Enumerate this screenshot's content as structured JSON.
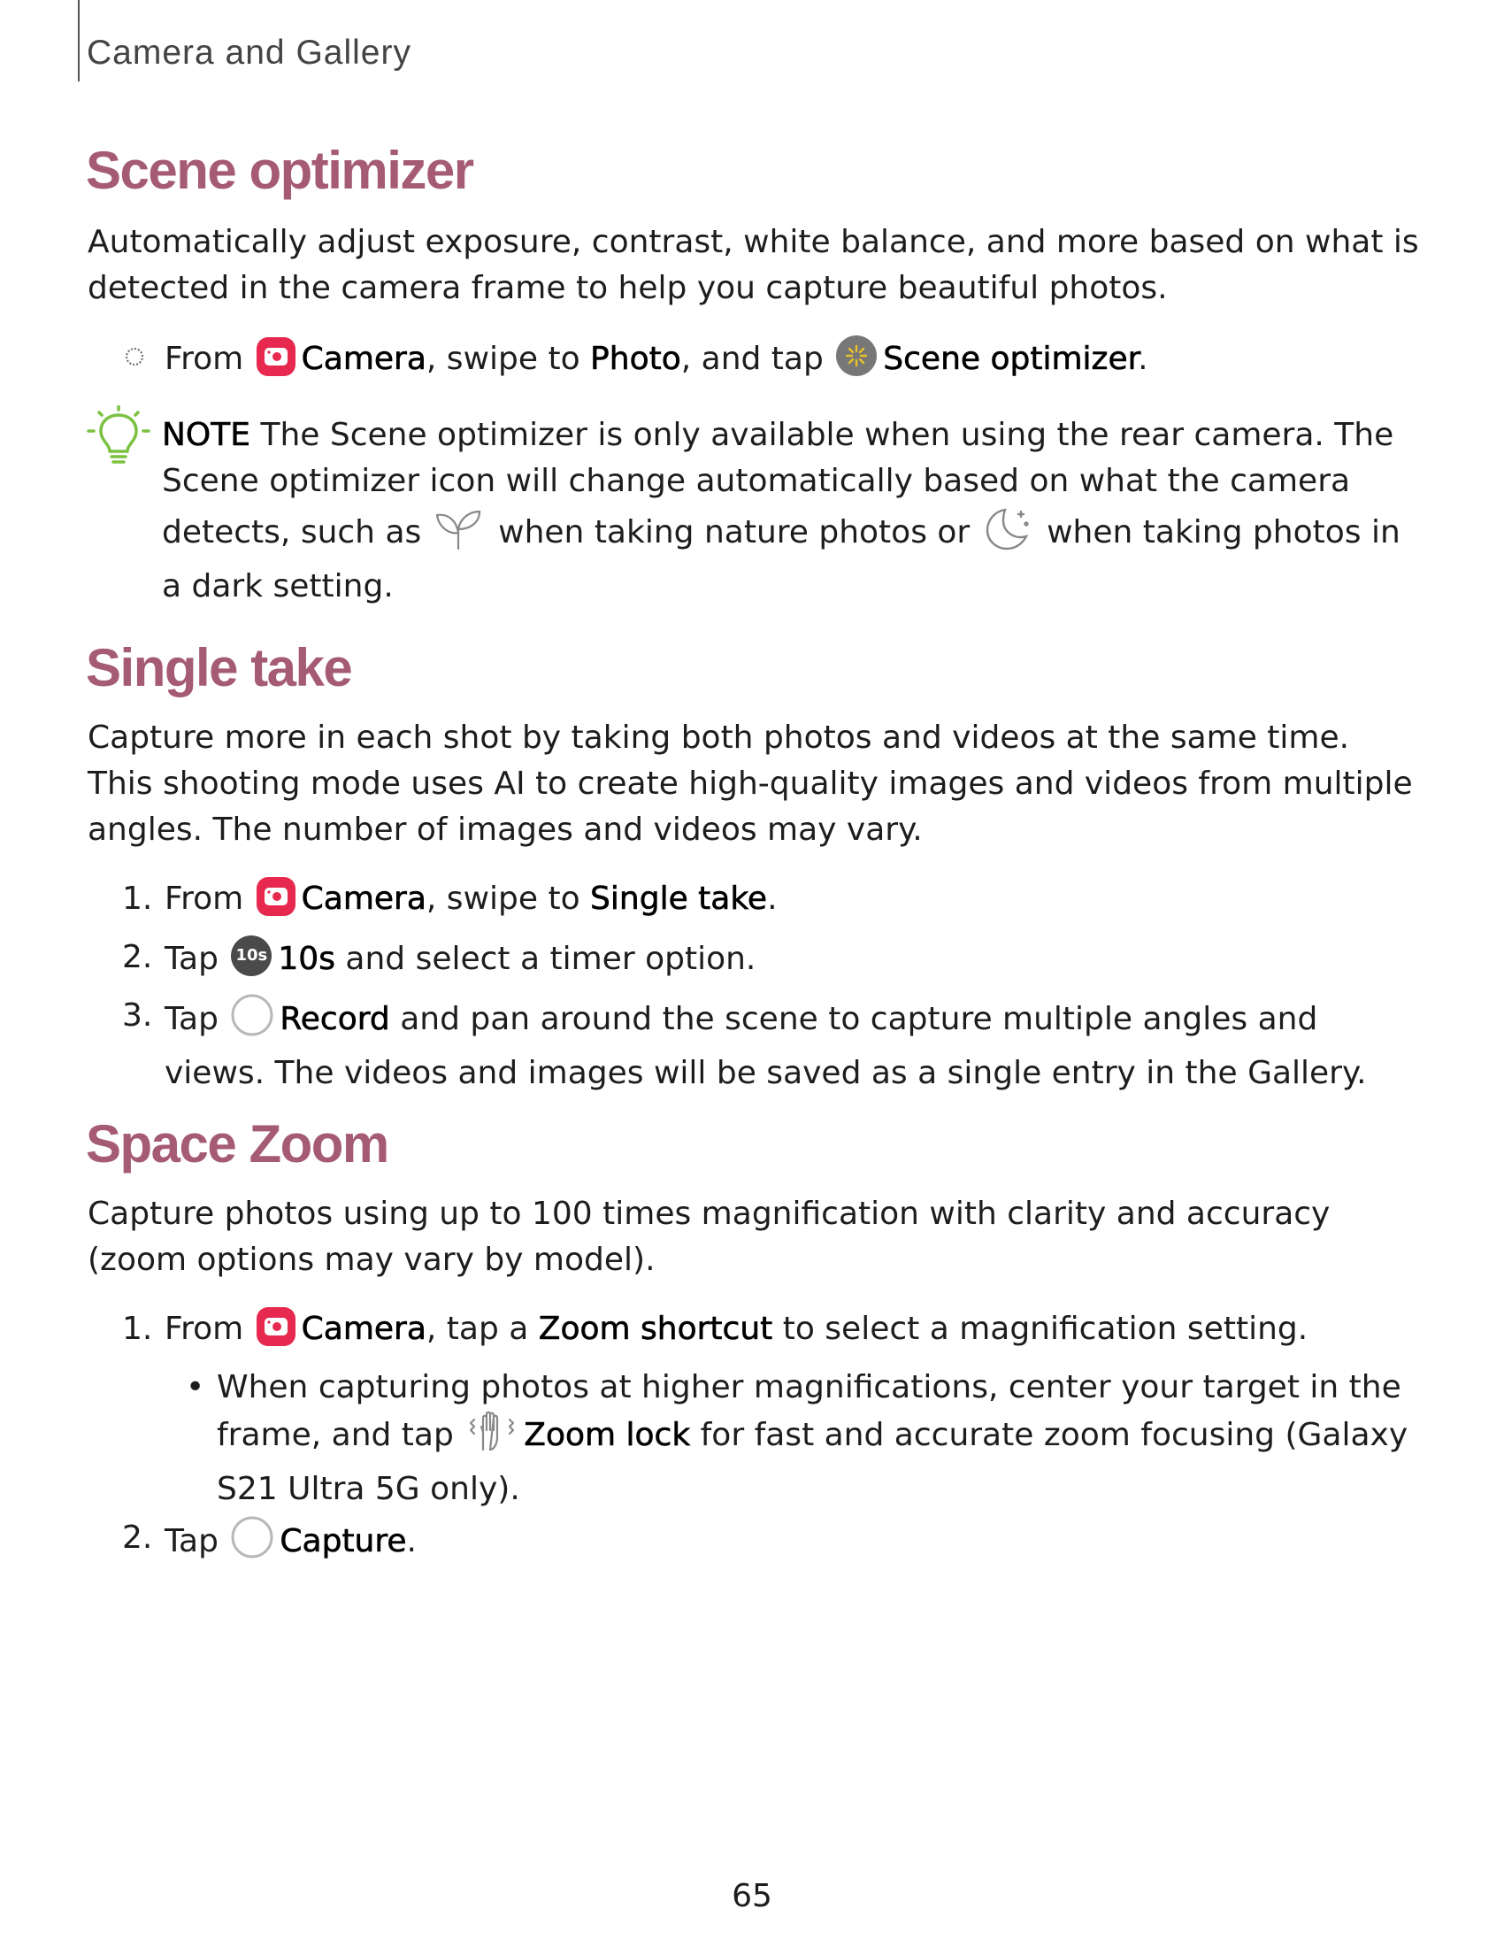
{
  "header": {
    "title": "Camera and Gallery"
  },
  "scene": {
    "title": "Scene optimizer",
    "intro": "Automatically adjust exposure, contrast, white balance, and more based on what is detected in the camera frame to help you capture beautiful photos.",
    "step": {
      "t1": "From ",
      "camera": "Camera",
      "t2": ", swipe to ",
      "photo": "Photo",
      "t3": ", and tap ",
      "optimizer": "Scene optimizer",
      "t4": "."
    },
    "note": {
      "label": "NOTE",
      "t1": " The Scene optimizer is only available when using the rear camera. The Scene optimizer icon will change automatically based on what the camera detects, such as ",
      "t2": " when taking nature photos or ",
      "t3": " when taking photos in a dark setting."
    }
  },
  "single": {
    "title": "Single take",
    "intro": "Capture more in each shot by taking both photos and videos at the same time. This shooting mode uses AI to create high-quality images and videos from multiple angles. The number of images and videos may vary.",
    "steps": [
      {
        "num": "1.",
        "t1": "From ",
        "camera": "Camera",
        "t2": ", swipe to ",
        "mode": "Single take",
        "t3": "."
      },
      {
        "num": "2.",
        "t1": "Tap ",
        "icon_text": "10s",
        "label": "10s",
        "t2": " and select a timer option."
      },
      {
        "num": "3.",
        "t1": "Tap ",
        "label": "Record",
        "t2": " and pan around the scene to capture multiple angles and views. The videos and images will be saved as a single entry in the Gallery."
      }
    ]
  },
  "space": {
    "title": "Space Zoom",
    "intro": "Capture photos using up to 100 times magnification with clarity and accuracy (zoom options may vary by model).",
    "steps": [
      {
        "num": "1.",
        "t1": "From ",
        "camera": "Camera",
        "t2": ", tap a ",
        "shortcut": "Zoom shortcut",
        "t3": " to select a magnification setting."
      },
      {
        "num": "2.",
        "t1": "Tap ",
        "label": "Capture",
        "t2": "."
      }
    ],
    "sub": {
      "bullet": "•",
      "t1": "When capturing photos at higher magnifications, center your target in the frame, and tap ",
      "label": "Zoom lock",
      "t2": " for fast and accurate zoom focusing (Galaxy S21 Ultra 5G only)."
    }
  },
  "page_number": "65",
  "colors": {
    "heading": "#a55b73",
    "camera_icon": "#e8294f",
    "note_icon": "#7cc242"
  },
  "icons": [
    "camera-icon",
    "scene-optimizer-icon",
    "lightbulb-icon",
    "leaf-icon",
    "moon-icon",
    "timer-10s-icon",
    "shutter-icon",
    "zoom-lock-icon"
  ]
}
